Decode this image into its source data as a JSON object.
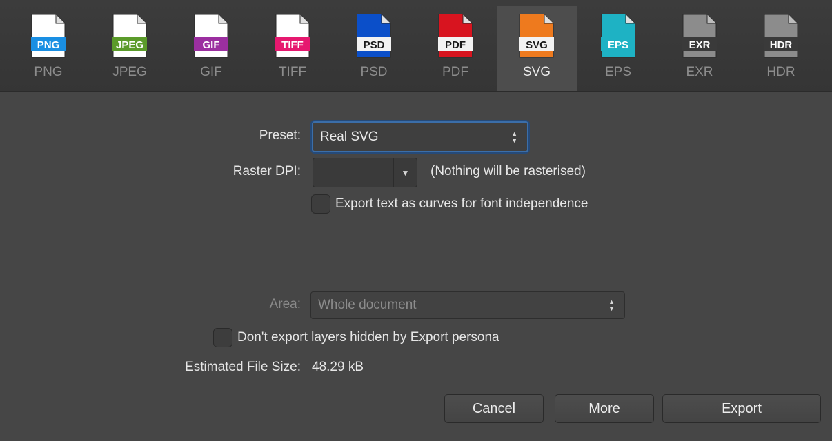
{
  "formats": [
    {
      "name": "PNG",
      "badge": "PNG",
      "color": "#1a8fe3",
      "active": false
    },
    {
      "name": "JPEG",
      "badge": "JPEG",
      "color": "#5b9b2a",
      "active": false
    },
    {
      "name": "GIF",
      "badge": "GIF",
      "color": "#9b2fa0",
      "active": false
    },
    {
      "name": "TIFF",
      "badge": "TIFF",
      "color": "#e6186f",
      "active": false
    },
    {
      "name": "PSD",
      "badge": "PSD",
      "color": "#0b4fc9",
      "active": false
    },
    {
      "name": "PDF",
      "badge": "PDF",
      "color": "#d8141f",
      "active": false
    },
    {
      "name": "SVG",
      "badge": "SVG",
      "color": "#ee7a1e",
      "active": true
    },
    {
      "name": "EPS",
      "badge": "EPS",
      "color": "#1eb2c4",
      "active": false
    },
    {
      "name": "EXR",
      "badge": "EXR",
      "color": "#5a5a5a",
      "active": false
    },
    {
      "name": "HDR",
      "badge": "HDR",
      "color": "#7a7a7a",
      "active": false
    }
  ],
  "preset": {
    "label": "Preset:",
    "value": "Real SVG"
  },
  "raster_dpi": {
    "label": "Raster DPI:",
    "value": "",
    "note": "(Nothing will be rasterised)"
  },
  "export_text_curves": {
    "label": "Export text as curves for font independence",
    "checked": false
  },
  "area": {
    "label": "Area:",
    "value": "Whole document"
  },
  "hidden_layers": {
    "label": "Don't export layers hidden by Export persona",
    "checked": false
  },
  "file_size": {
    "label": "Estimated File Size:",
    "value": "48.29 kB"
  },
  "buttons": {
    "cancel": "Cancel",
    "more": "More",
    "export": "Export"
  }
}
